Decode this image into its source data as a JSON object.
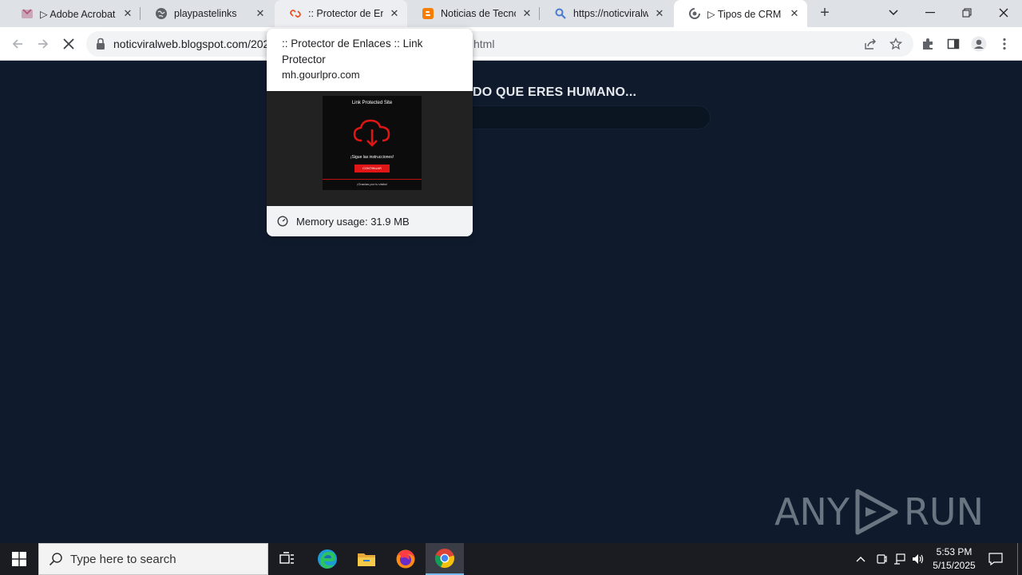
{
  "browser": {
    "tabs": [
      {
        "title": "▷ Adobe Acrobat l",
        "favicon": "acrobat-icon"
      },
      {
        "title": "playpastelinks",
        "favicon": "globe-icon"
      },
      {
        "title": ":: Protector de Enla",
        "favicon": "link-protector-icon"
      },
      {
        "title": "Noticias de Tecnol",
        "favicon": "blogger-icon"
      },
      {
        "title": "https://noticviralw",
        "favicon": "search-icon"
      },
      {
        "title": "▷ Tipos de CRM y",
        "favicon": "loading-icon"
      }
    ],
    "active_tab_index": 5,
    "hovered_tab_index": 2,
    "url_visible": "noticviralweb.blogspot.com/202",
    "url_tail": "html"
  },
  "hover_card": {
    "title": ":: Protector de Enlaces :: Link Protector",
    "domain": "mh.gourlpro.com",
    "thumbnail": {
      "title": "Link Protected Site",
      "caption": "¡Sigue las instrucciones!",
      "button": "CONTINUAR",
      "footer": "¡Gracias por tu visita!"
    },
    "memory": "Memory usage: 31.9 MB"
  },
  "page": {
    "heading": "DO QUE ERES HUMANO...",
    "watermark_left": "ANY",
    "watermark_right": "RUN"
  },
  "taskbar": {
    "search_placeholder": "Type here to search",
    "time": "5:53 PM",
    "date": "5/15/2025",
    "apps": [
      "task-view-icon",
      "edge-icon",
      "file-explorer-icon",
      "firefox-icon",
      "chrome-icon"
    ]
  },
  "colors": {
    "page_bg": "#0f1b2d",
    "tabstrip_bg": "#dee1e6",
    "taskbar_bg": "#1a1c22",
    "thumb_accent": "#e01616"
  }
}
